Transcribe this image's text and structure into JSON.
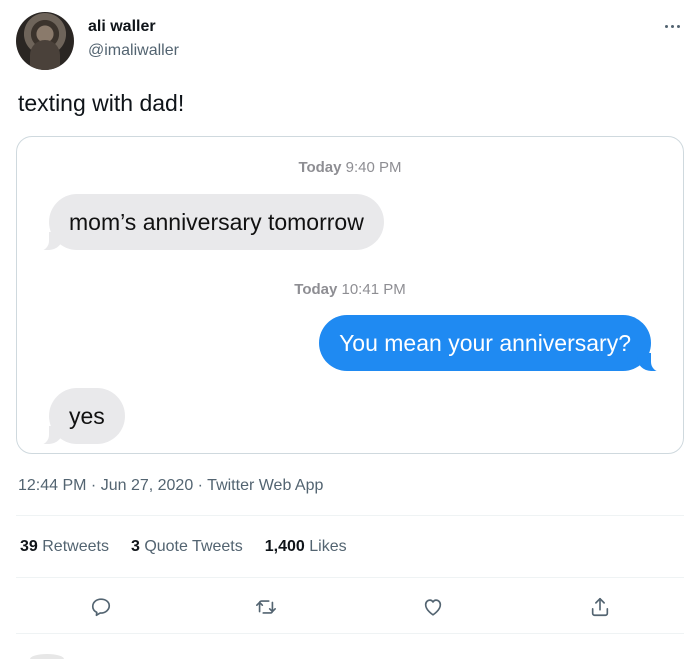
{
  "author": {
    "display_name": "ali waller",
    "handle": "@imaliwaller"
  },
  "tweet": {
    "text": "texting with dad!"
  },
  "conversation": {
    "time1": {
      "day": "Today",
      "time": "9:40 PM"
    },
    "msg1": "mom’s anniversary tomorrow",
    "time2": {
      "day": "Today",
      "time": "10:41 PM"
    },
    "msg2": "You mean your anniversary?",
    "msg3": "yes"
  },
  "meta": {
    "time": "12:44 PM",
    "sep1": " · ",
    "date": "Jun 27, 2020",
    "sep2": " · ",
    "app": "Twitter Web App"
  },
  "stats": {
    "retweets": {
      "count": "39",
      "label": "Retweets"
    },
    "quotes": {
      "count": "3",
      "label": "Quote Tweets"
    },
    "likes": {
      "count": "1,400",
      "label": "Likes"
    }
  },
  "colors": {
    "incoming_bubble": "#e9e9eb",
    "outgoing_bubble": "#1f8af2",
    "secondary_text": "#536471"
  },
  "icons": {
    "more": "more-icon",
    "reply": "reply-icon",
    "retweet": "retweet-icon",
    "like": "heart-icon",
    "share": "share-icon"
  }
}
